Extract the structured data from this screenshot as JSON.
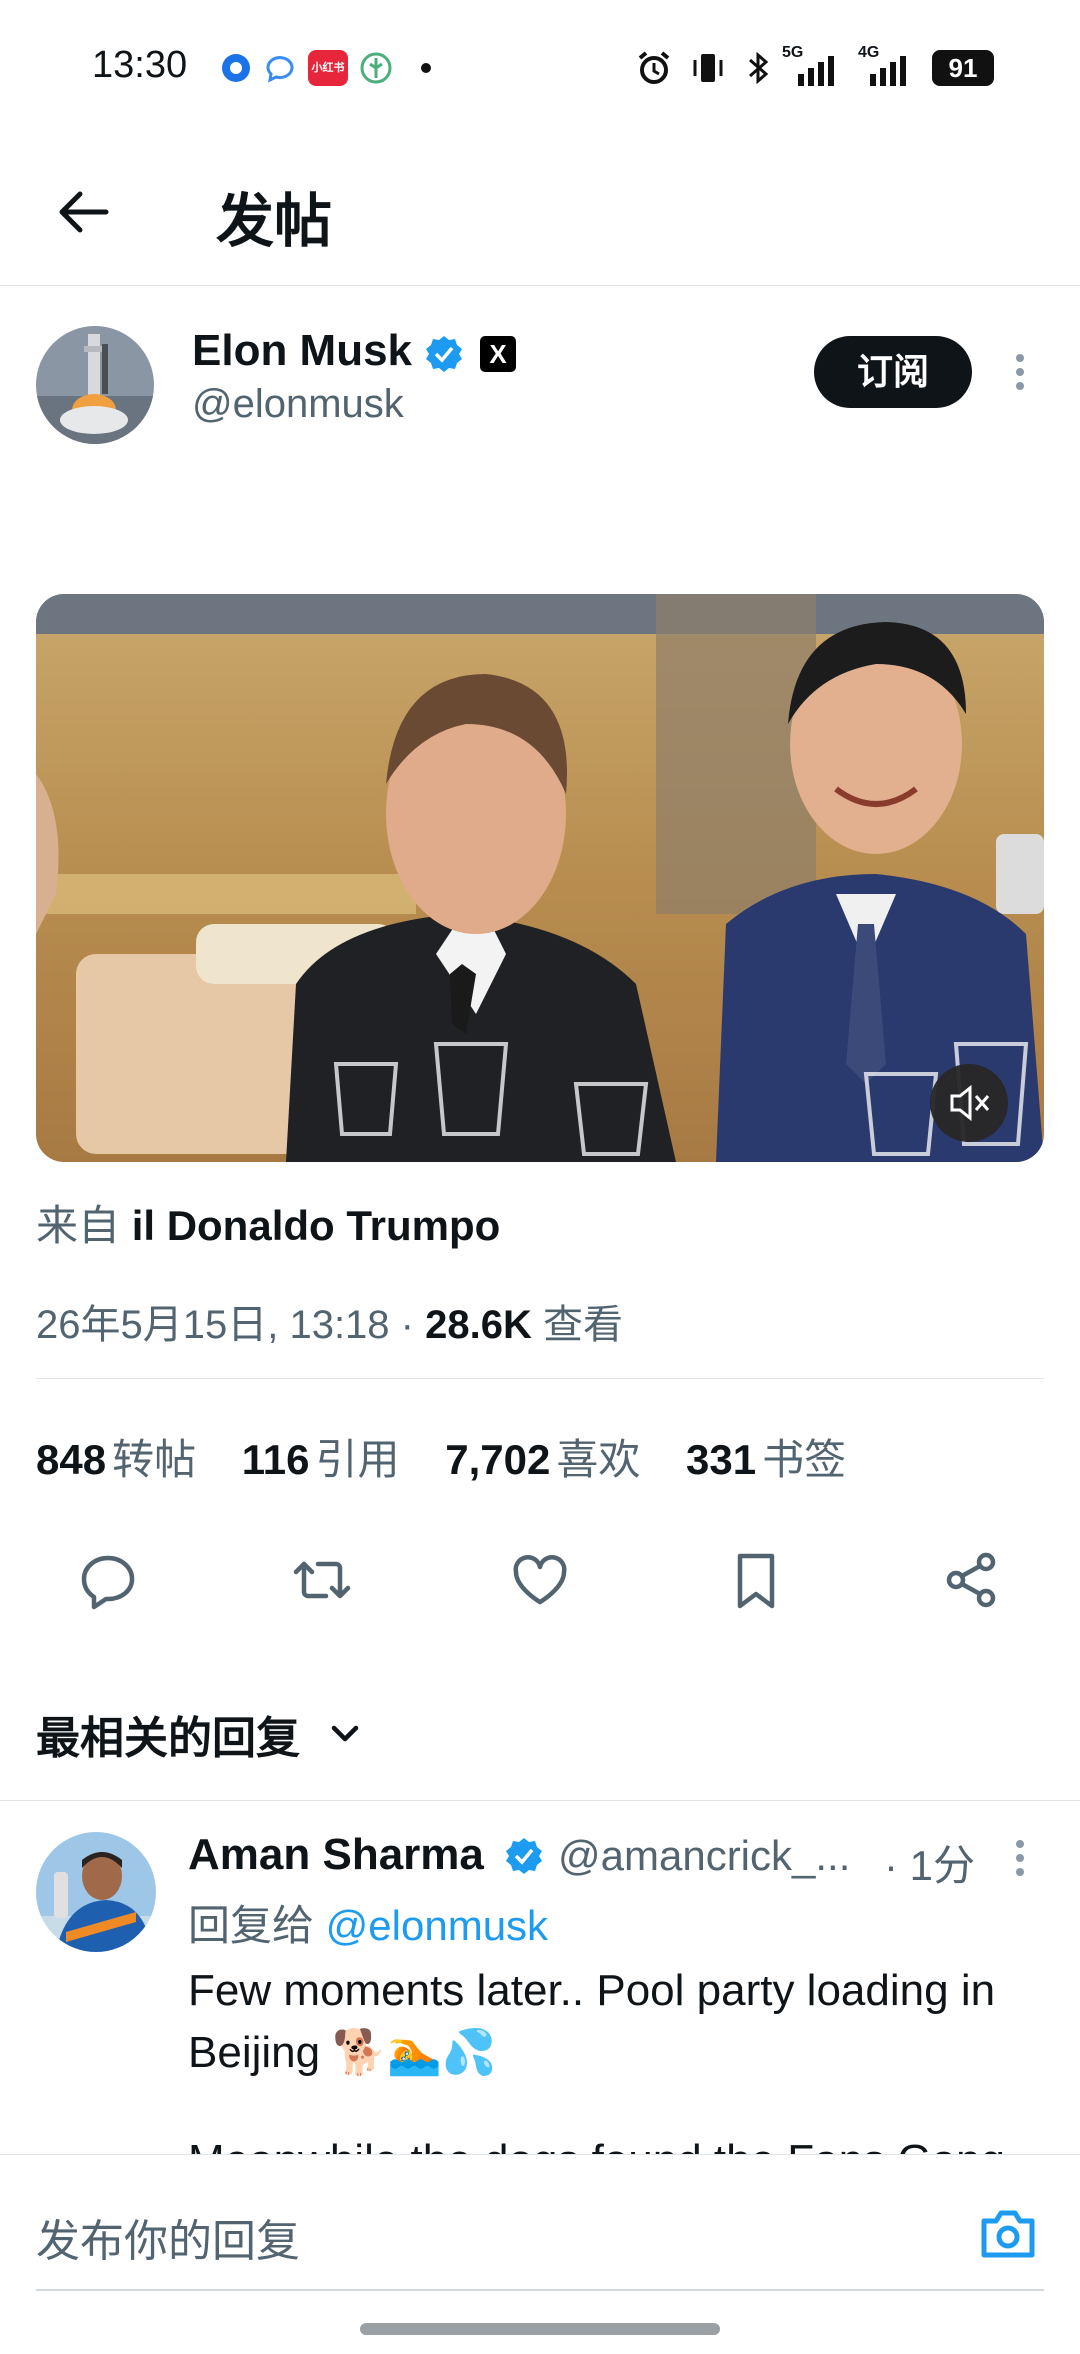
{
  "status_bar": {
    "time": "13:30",
    "battery": "91",
    "network_5g": "5G",
    "network_4g": "4G",
    "app_badge": "小红书"
  },
  "header": {
    "title": "发帖"
  },
  "post": {
    "author_name": "Elon Musk",
    "author_handle": "@elonmusk",
    "x_badge": "X",
    "subscribe_label": "订阅",
    "source_prefix": "来自",
    "source_name": "il Donaldo Trumpo",
    "date": "26年5月15日, 13:18 · ",
    "views_count": "28.6K",
    "views_label": " 查看",
    "stats": [
      {
        "num": "848",
        "label": "转帖"
      },
      {
        "num": "116",
        "label": "引用"
      },
      {
        "num": "7,702",
        "label": "喜欢"
      },
      {
        "num": "331",
        "label": "书签"
      }
    ]
  },
  "replies": {
    "sort_label": "最相关的回复"
  },
  "reply": {
    "name": "Aman Sharma",
    "handle": "@amancrick_...",
    "time": "· 1分",
    "reply_to_prefix": "回复给 ",
    "reply_to_handle": "@elonmusk",
    "text": "Few moments later.. Pool party loading in Beijing 🐕🏊💦",
    "text_continued": "Meanwhile the dogs found the Fans Gang"
  },
  "composer": {
    "placeholder": "发布你的回复"
  },
  "colors": {
    "accent": "#1d9bf0",
    "text_primary": "#0f1419",
    "text_secondary": "#536471"
  }
}
